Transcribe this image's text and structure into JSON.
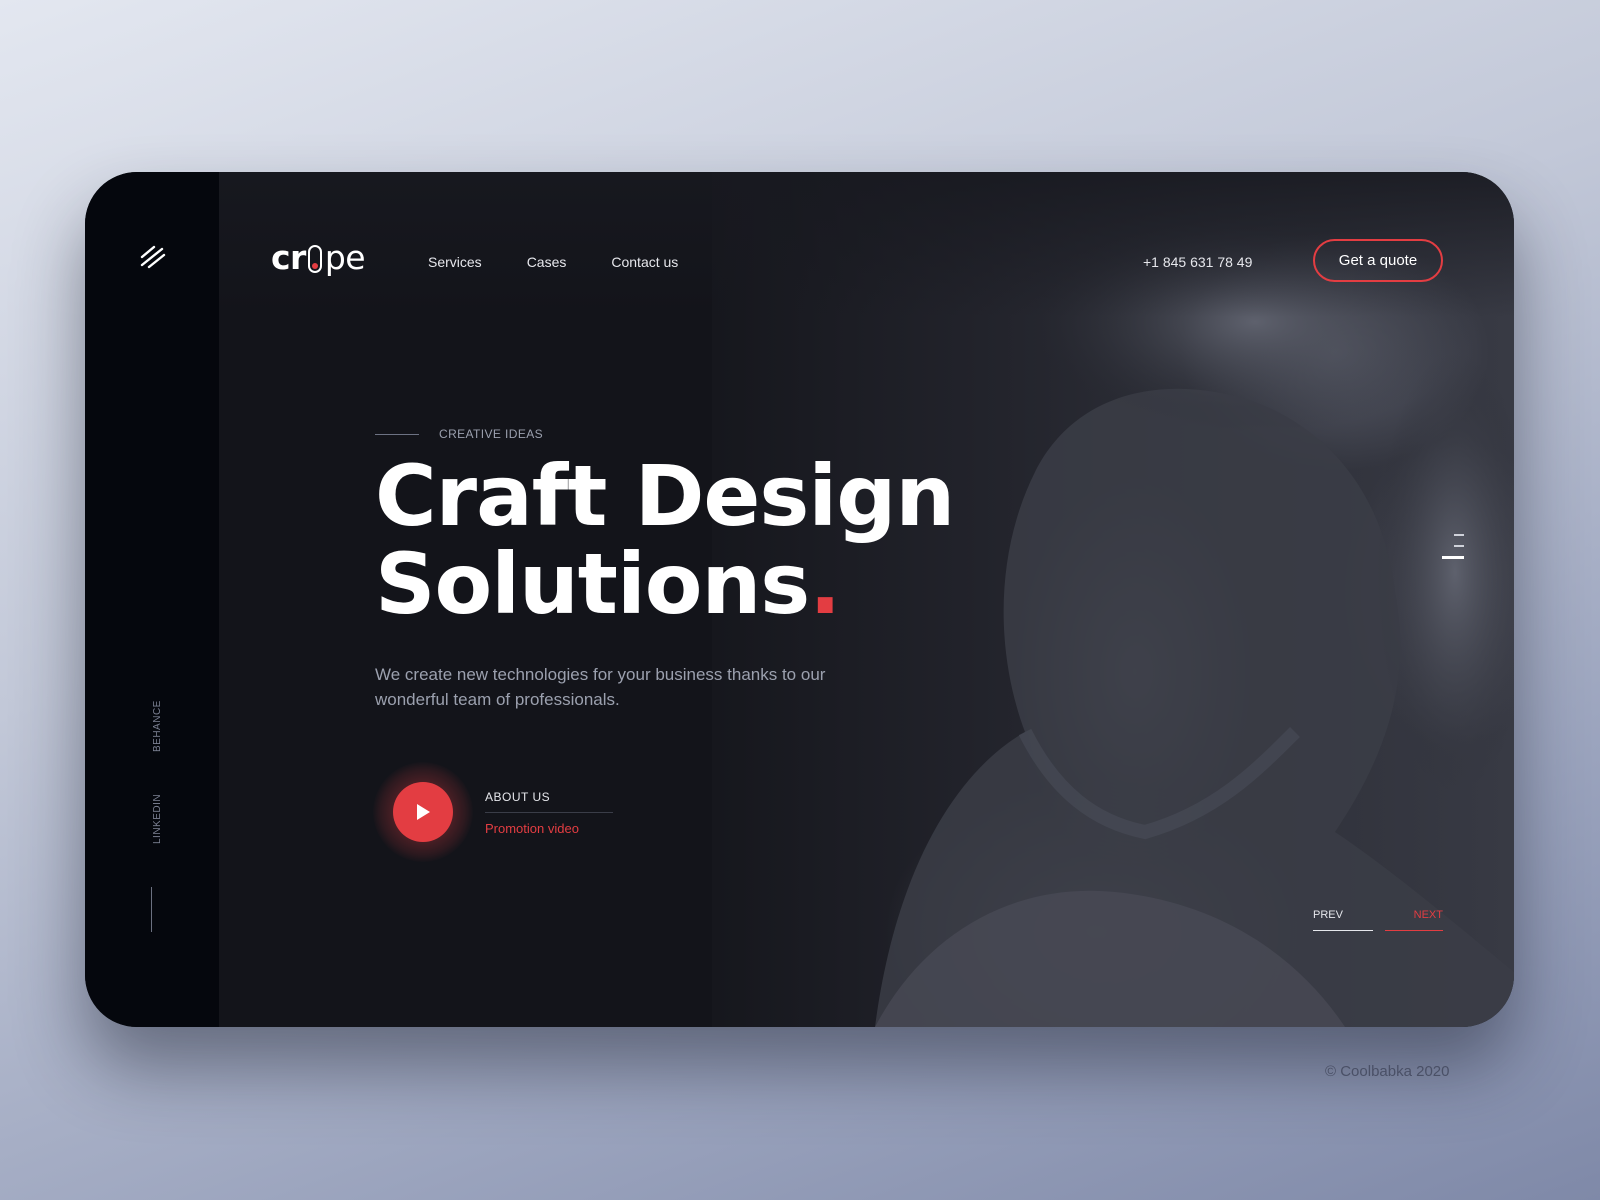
{
  "brand": {
    "logo_left": "cr",
    "logo_right": "pe"
  },
  "nav": {
    "items": [
      "Services",
      "Cases",
      "Contact us"
    ]
  },
  "header": {
    "phone": "+1 845 631 78 49",
    "cta_label": "Get a quote"
  },
  "hero": {
    "eyebrow": "CREATIVE IDEAS",
    "title_line1": "Craft Design",
    "title_line2": "Solutions",
    "title_dot": ".",
    "description": "We create new technologies for your business thanks to our wonderful team of professionals."
  },
  "video": {
    "label": "ABOUT US",
    "link": "Promotion video"
  },
  "social": {
    "behance": "BEHANCE",
    "linkedin": "LINKEDIN"
  },
  "slider": {
    "prev": "PREV",
    "next": "NEXT",
    "indicator_count": 3,
    "active_index": 2
  },
  "footer": {
    "copyright": "© Coolbabka 2020"
  },
  "colors": {
    "accent": "#e33d42",
    "dark": "#121318",
    "sidebar": "#05070d"
  },
  "icons": [
    "menu-icon",
    "play-icon"
  ]
}
